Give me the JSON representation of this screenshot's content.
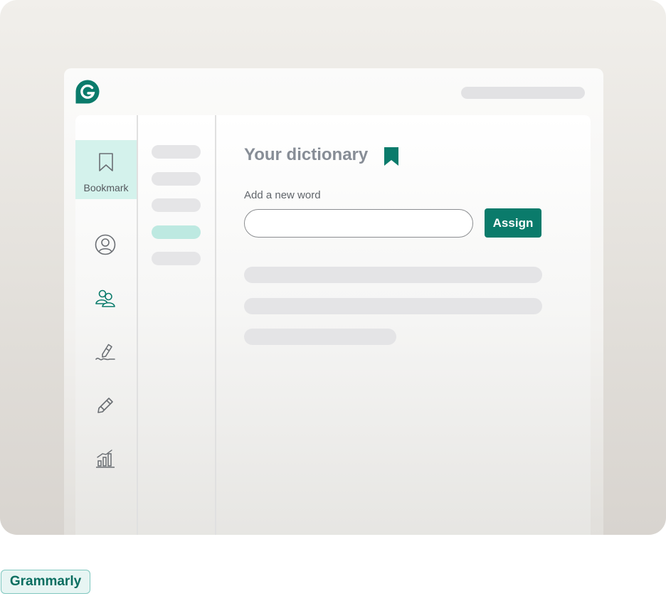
{
  "colors": {
    "accent": "#0a7b6b",
    "active_nav_bg": "#d4f2ec",
    "active_nav_bar": "#3ccfb3",
    "placeholder_gray": "#e4e4e6"
  },
  "logo": {
    "icon": "grammarly-g-logo"
  },
  "sidebar": {
    "items": [
      {
        "icon": "bookmark-icon",
        "label": "Bookmark",
        "active": true
      },
      {
        "icon": "user-icon",
        "active": false
      },
      {
        "icon": "users-icon",
        "active": false
      },
      {
        "icon": "pen-signature-icon",
        "active": false
      },
      {
        "icon": "pencil-icon",
        "active": false
      },
      {
        "icon": "bar-chart-icon",
        "active": false
      }
    ]
  },
  "subnav": {
    "active_index": 3
  },
  "main": {
    "title": "Your dictionary",
    "title_icon": "bookmark-filled-icon",
    "field_label": "Add a new word",
    "input_value": "",
    "input_placeholder": "",
    "assign_label": "Assign"
  },
  "badge": {
    "label": "Grammarly"
  }
}
